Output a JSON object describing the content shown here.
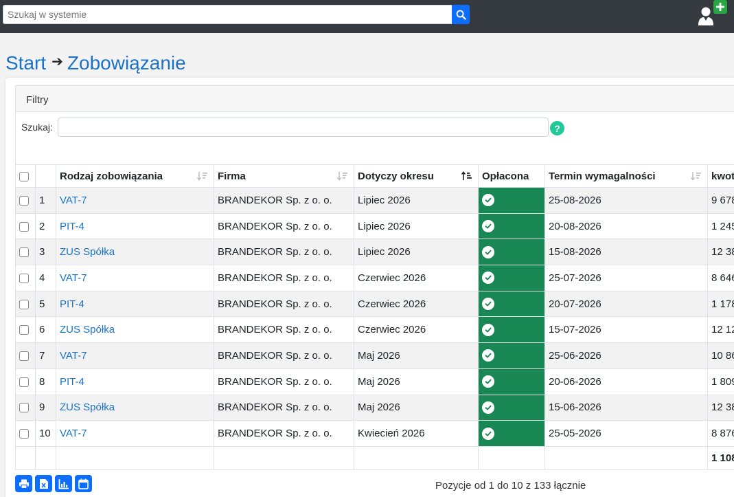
{
  "header": {
    "search_placeholder": "Szukaj w systemie"
  },
  "breadcrumb": {
    "start": "Start",
    "current": "Zobowiązanie"
  },
  "filters": {
    "title": "Filtry",
    "search_label": "Szukaj:",
    "search_value": ""
  },
  "table": {
    "columns": [
      "Rodzaj zobowiązania",
      "Firma",
      "Dotyczy okresu",
      "Opłacona",
      "Termin wymagalności",
      "kwot"
    ],
    "rows": [
      {
        "n": "1",
        "type": "VAT-7",
        "firm": "BRANDEKOR Sp. z o. o.",
        "period": "Lipiec 2026",
        "due": "25-08-2026",
        "amount": "9 678"
      },
      {
        "n": "2",
        "type": "PIT-4",
        "firm": "BRANDEKOR Sp. z o. o.",
        "period": "Lipiec 2026",
        "due": "20-08-2026",
        "amount": "1 245"
      },
      {
        "n": "3",
        "type": "ZUS Spółka",
        "firm": "BRANDEKOR Sp. z o. o.",
        "period": "Lipiec 2026",
        "due": "15-08-2026",
        "amount": "12 38"
      },
      {
        "n": "4",
        "type": "VAT-7",
        "firm": "BRANDEKOR Sp. z o. o.",
        "period": "Czerwiec 2026",
        "due": "25-07-2026",
        "amount": "8 646"
      },
      {
        "n": "5",
        "type": "PIT-4",
        "firm": "BRANDEKOR Sp. z o. o.",
        "period": "Czerwiec 2026",
        "due": "20-07-2026",
        "amount": "1 178"
      },
      {
        "n": "6",
        "type": "ZUS Spółka",
        "firm": "BRANDEKOR Sp. z o. o.",
        "period": "Czerwiec 2026",
        "due": "15-07-2026",
        "amount": "12 12"
      },
      {
        "n": "7",
        "type": "VAT-7",
        "firm": "BRANDEKOR Sp. z o. o.",
        "period": "Maj 2026",
        "due": "25-06-2026",
        "amount": "10 86"
      },
      {
        "n": "8",
        "type": "PIT-4",
        "firm": "BRANDEKOR Sp. z o. o.",
        "period": "Maj 2026",
        "due": "20-06-2026",
        "amount": "1 809"
      },
      {
        "n": "9",
        "type": "ZUS Spółka",
        "firm": "BRANDEKOR Sp. z o. o.",
        "period": "Maj 2026",
        "due": "15-06-2026",
        "amount": "12 38"
      },
      {
        "n": "10",
        "type": "VAT-7",
        "firm": "BRANDEKOR Sp. z o. o.",
        "period": "Kwiecień 2026",
        "due": "25-05-2026",
        "amount": "8 876"
      }
    ],
    "total": "1 108"
  },
  "pagination": {
    "info": "Pozycje od 1 do 10 z 133 łącznie"
  },
  "icons": {
    "search": "search-icon",
    "add_user": "add-user-icon",
    "help": "help-icon",
    "paid": "check-circle-icon",
    "print": "print-icon",
    "excel": "excel-icon",
    "chart": "chart-icon",
    "calendar": "calendar-icon"
  },
  "colors": {
    "topbar": "#343a40",
    "accent": "#0d6efd",
    "link": "#1a73c8",
    "paid": "#198754"
  }
}
